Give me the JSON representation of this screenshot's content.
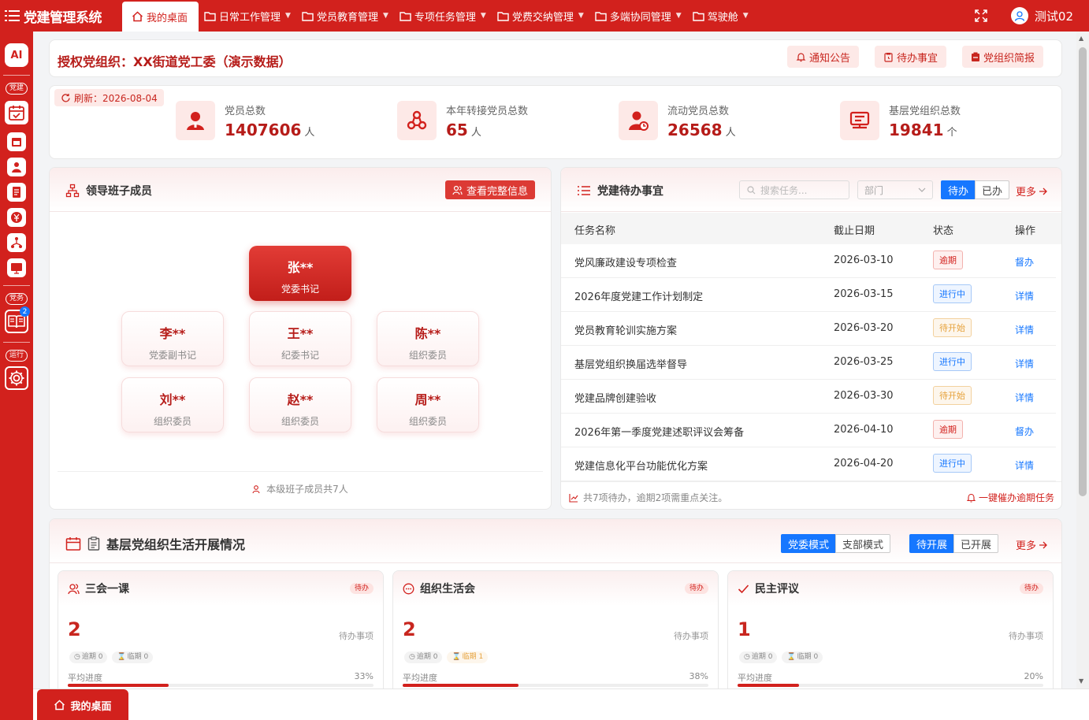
{
  "app": {
    "title": "党建管理系统"
  },
  "nav": [
    {
      "label": "我的桌面",
      "active": true
    },
    {
      "label": "日常工作管理"
    },
    {
      "label": "党员教育管理"
    },
    {
      "label": "专项任务管理"
    },
    {
      "label": "党费交纳管理"
    },
    {
      "label": "多端协同管理"
    },
    {
      "label": "驾驶舱"
    }
  ],
  "user": {
    "name": "测试02"
  },
  "sidebar": {
    "ai": "AI",
    "group1": "党建",
    "group2": "党务",
    "group3": "运行",
    "badge": "2"
  },
  "org": {
    "title": "授权党组织：XX街道党工委（演示数据）"
  },
  "quick": [
    "通知公告",
    "待办事宜",
    "党组织简报"
  ],
  "stats": {
    "refresh": "刷新：2026-08-04",
    "items": [
      {
        "label": "党员总数",
        "value": "1407606",
        "unit": "人"
      },
      {
        "label": "本年转接党员总数",
        "value": "65",
        "unit": "人"
      },
      {
        "label": "流动党员总数",
        "value": "26568",
        "unit": "人"
      },
      {
        "label": "基层党组织总数",
        "value": "19841",
        "unit": "个"
      }
    ]
  },
  "leaders": {
    "title": "领导班子成员",
    "button": "查看完整信息",
    "members": [
      {
        "name": "张**",
        "role": "党委书记"
      },
      {
        "name": "李**",
        "role": "党委副书记"
      },
      {
        "name": "王**",
        "role": "纪委书记"
      },
      {
        "name": "陈**",
        "role": "组织委员"
      },
      {
        "name": "刘**",
        "role": "组织委员"
      },
      {
        "name": "赵**",
        "role": "组织委员"
      },
      {
        "name": "周**",
        "role": "组织委员"
      }
    ],
    "footer": "本级班子成员共7人"
  },
  "tasks": {
    "title": "党建待办事宜",
    "search_placeholder": "搜索任务...",
    "dept_placeholder": "部门",
    "toggle": [
      "待办",
      "已办"
    ],
    "more": "更多",
    "columns": [
      "任务名称",
      "截止日期",
      "状态",
      "操作"
    ],
    "rows": [
      {
        "name": "党风廉政建设专项检查",
        "date": "2026-03-10",
        "status": "逾期",
        "op": "督办"
      },
      {
        "name": "2026年度党建工作计划制定",
        "date": "2026-03-15",
        "status": "进行中",
        "op": "详情"
      },
      {
        "name": "党员教育轮训实施方案",
        "date": "2026-03-20",
        "status": "待开始",
        "op": "详情"
      },
      {
        "name": "基层党组织换届选举督导",
        "date": "2026-03-25",
        "status": "进行中",
        "op": "详情"
      },
      {
        "name": "党建品牌创建验收",
        "date": "2026-03-30",
        "status": "待开始",
        "op": "详情"
      },
      {
        "name": "2026年第一季度党建述职评议会筹备",
        "date": "2026-04-10",
        "status": "逾期",
        "op": "督办"
      },
      {
        "name": "党建信息化平台功能优化方案",
        "date": "2026-04-20",
        "status": "进行中",
        "op": "详情"
      }
    ],
    "footer_left": "共7项待办，逾期2项需重点关注。",
    "footer_right": "一键催办逾期任务"
  },
  "life": {
    "title": "基层党组织生活开展情况",
    "mode": [
      "党委模式",
      "支部模式"
    ],
    "state": [
      "待开展",
      "已开展"
    ],
    "more": "更多",
    "cards": [
      {
        "title": "三会一课",
        "badge": "待办",
        "count": "2",
        "pending": "待办事项",
        "overdue": "逾期 0",
        "near": "临期 0",
        "progress_label": "平均进度",
        "progress": 33,
        "progress_text": "33%"
      },
      {
        "title": "组织生活会",
        "badge": "待办",
        "count": "2",
        "pending": "待办事项",
        "overdue": "逾期 0",
        "near": "临期 1",
        "progress_label": "平均进度",
        "progress": 38,
        "progress_text": "38%"
      },
      {
        "title": "民主评议",
        "badge": "待办",
        "count": "1",
        "pending": "待办事项",
        "overdue": "逾期 0",
        "near": "临期 0",
        "progress_label": "平均进度",
        "progress": 20,
        "progress_text": "20%"
      }
    ]
  },
  "bottom_tab": "我的桌面",
  "colors": {
    "primary": "#d2211d",
    "accent_blue": "#1677ff"
  }
}
